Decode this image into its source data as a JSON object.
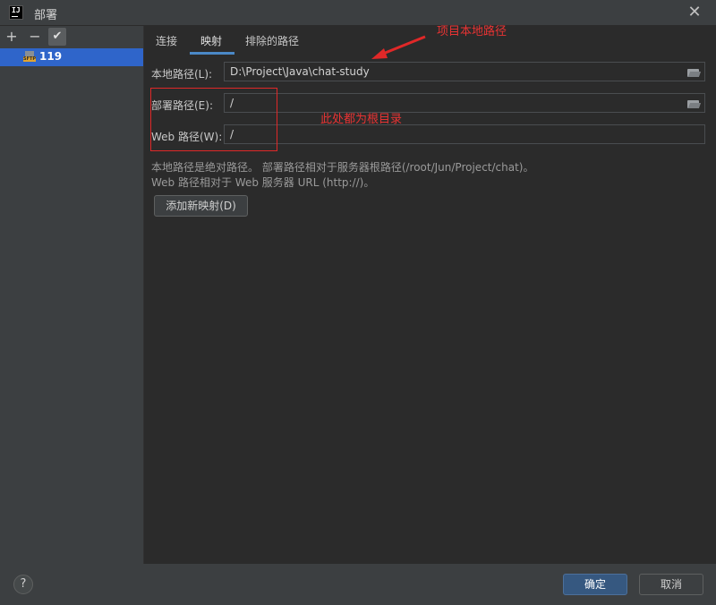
{
  "window": {
    "title": "部署",
    "app_icon_text": "IJ",
    "close_glyph": "✕"
  },
  "sidebar": {
    "toolbar": {
      "add": "+",
      "remove": "−",
      "apply": "✔"
    },
    "servers": [
      {
        "label": "119",
        "icon_text": "SFTP"
      }
    ]
  },
  "tabs": [
    {
      "label": "连接"
    },
    {
      "label": "映射",
      "active": true
    },
    {
      "label": "排除的路径"
    }
  ],
  "mapping": {
    "local_path": {
      "label": "本地路径(L):",
      "value": "D:\\Project\\Java\\chat-study"
    },
    "deploy_path": {
      "label": "部署路径(E):",
      "value": "/"
    },
    "web_path": {
      "label": "Web 路径(W):",
      "value": "/"
    },
    "help_line1": "本地路径是绝对路径。 部署路径相对于服务器根路径(/root/Jun/Project/chat)。",
    "help_line2": "Web 路径相对于 Web 服务器 URL (http://)。",
    "add_mapping_button": "添加新映射(D)"
  },
  "annotations": {
    "local_path_note": "项目本地路径",
    "root_note": "此处都为根目录",
    "color": "#e02828"
  },
  "footer": {
    "help": "?",
    "ok": "确定",
    "cancel": "取消"
  },
  "colors": {
    "background": "#2b2b2b",
    "panel": "#3c3f41",
    "selection": "#2f65ca",
    "tab_underline": "#4a88c7",
    "primary_button": "#365880"
  }
}
